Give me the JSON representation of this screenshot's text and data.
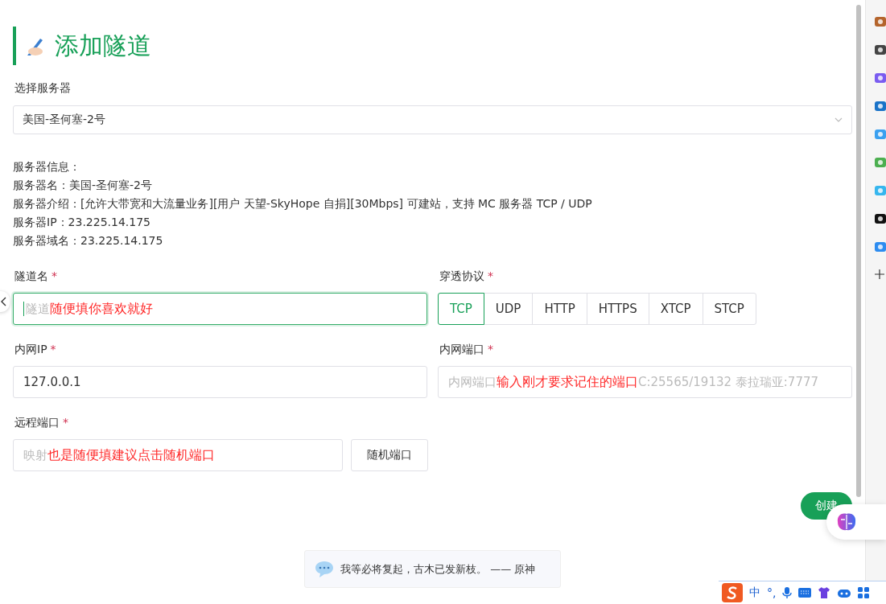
{
  "page": {
    "title": "添加隧道"
  },
  "server": {
    "label": "选择服务器",
    "value": "美国-圣何塞-2号"
  },
  "server_info": [
    "服务器信息：",
    "服务器名：美国-圣何塞-2号",
    "服务器介绍：[允许大带宽和大流量业务][用户 天望-SkyHope 自捐][30Mbps] 可建站，支持 MC 服务器 TCP / UDP",
    "服务器IP：23.225.14.175",
    "服务器域名：23.225.14.175"
  ],
  "fields": [
    {
      "kind": "input",
      "label": "隧道名",
      "required_mark": "*",
      "focused": true,
      "placeholder": "隧道",
      "annotation": "随便填你喜欢就好"
    },
    {
      "kind": "segmented",
      "label": "穿透协议",
      "required_mark": "*",
      "options": [
        {
          "label": "TCP",
          "selected": true
        },
        {
          "label": "UDP",
          "selected": false
        },
        {
          "label": "HTTP",
          "selected": false
        },
        {
          "label": "HTTPS",
          "selected": false
        },
        {
          "label": "XTCP",
          "selected": false
        },
        {
          "label": "STCP",
          "selected": false
        }
      ]
    },
    {
      "kind": "input",
      "label": "内网IP",
      "required_mark": "*",
      "focused": false,
      "value": "127.0.0.1"
    },
    {
      "kind": "input",
      "label": "内网端口",
      "required_mark": "*",
      "focused": false,
      "placeholder": "内网端口",
      "annotation": "输入刚才要求记住的端口",
      "placeholder_tail": "C:25565/19132 泰拉瑞亚:7777"
    }
  ],
  "remote_port": {
    "label": "远程端口",
    "required_mark": "*",
    "placeholder": "映射",
    "annotation": "也是随便填建议点击随机端口",
    "button": "随机端口"
  },
  "create_button": "创建",
  "quote": "我等必将复起，古木已发新枝。 —— 原神",
  "ime_bar": {
    "mode": "中",
    "punctuation": "°,"
  }
}
